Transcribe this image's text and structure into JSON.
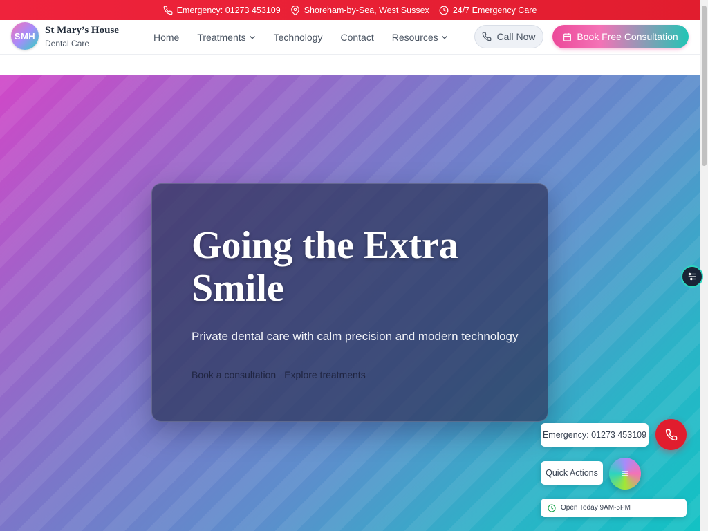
{
  "topbar": {
    "emergency": "Emergency: 01273 453109",
    "location": "Shoreham-by-Sea, West Sussex",
    "care": "24/7 Emergency Care"
  },
  "brand": {
    "badge": "SMH",
    "name": "St Mary’s House",
    "sub": "Dental Care"
  },
  "nav": {
    "items": [
      {
        "label": "Home"
      },
      {
        "label": "Treatments",
        "dropdown": true
      },
      {
        "label": "Technology"
      },
      {
        "label": "Contact"
      },
      {
        "label": "Resources",
        "dropdown": true
      }
    ]
  },
  "actions": {
    "call": "Call Now",
    "book": "Book Free Consultation"
  },
  "hero": {
    "title": "Going the Extra Smile",
    "subtitle": "Private dental care with calm precision and modern technology",
    "link_book": "Book a consultation",
    "link_explore": "Explore treatments"
  },
  "floating": {
    "emergency": "Emergency: 01273 453109",
    "quick": "Quick Actions",
    "open": "Open Today 9AM-5PM"
  },
  "colors": {
    "accent_red": "#e11d2e",
    "accent_pink": "#ec4899",
    "accent_teal": "#2dd4bf"
  }
}
